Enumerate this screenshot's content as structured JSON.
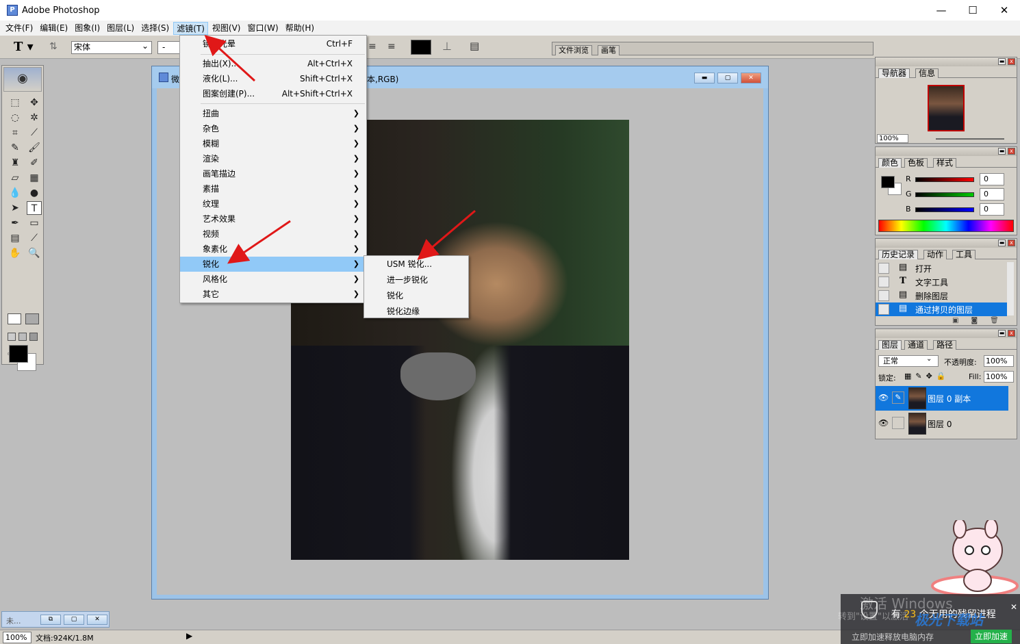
{
  "app": {
    "title": "Adobe Photoshop"
  },
  "menubar": [
    "文件(F)",
    "编辑(E)",
    "图象(I)",
    "图层(L)",
    "选择(S)",
    "滤镜(T)",
    "视图(V)",
    "窗口(W)",
    "帮助(H)"
  ],
  "toolbar": {
    "font": "宋体",
    "style": "-"
  },
  "well": {
    "tab1": "文件浏览",
    "tab2": "画笔"
  },
  "document": {
    "title_left": "微",
    "title_right": "本,RGB)"
  },
  "filter_menu": {
    "items": [
      {
        "label": "镜头光晕",
        "shortcut": "Ctrl+F"
      },
      {
        "label": "抽出(X)...",
        "shortcut": "Alt+Ctrl+X"
      },
      {
        "label": "液化(L)...",
        "shortcut": "Shift+Ctrl+X"
      },
      {
        "label": "图案创建(P)...",
        "shortcut": "Alt+Shift+Ctrl+X"
      },
      {
        "label": "扭曲"
      },
      {
        "label": "杂色"
      },
      {
        "label": "模糊"
      },
      {
        "label": "渲染"
      },
      {
        "label": "画笔描边"
      },
      {
        "label": "素描"
      },
      {
        "label": "纹理"
      },
      {
        "label": "艺术效果"
      },
      {
        "label": "视频"
      },
      {
        "label": "象素化"
      },
      {
        "label": "锐化"
      },
      {
        "label": "风格化"
      },
      {
        "label": "其它"
      }
    ]
  },
  "sharpen_submenu": [
    "USM 锐化...",
    "进一步锐化",
    "锐化",
    "锐化边缘"
  ],
  "navigator": {
    "tab1": "导航器",
    "tab2": "信息",
    "zoom": "100%"
  },
  "color_panel": {
    "tab1": "颜色",
    "tab2": "色板",
    "tab3": "样式",
    "r_label": "R",
    "g_label": "G",
    "b_label": "B",
    "r": "0",
    "g": "0",
    "b": "0"
  },
  "history_panel": {
    "tab1": "历史记录",
    "tab2": "动作",
    "tab3": "工具",
    "items": [
      "打开",
      "文字工具",
      "删除图层",
      "通过拷贝的图层"
    ]
  },
  "layers_panel": {
    "tab1": "图层",
    "tab2": "通道",
    "tab3": "路径",
    "blend": "正常",
    "opacity_label": "不透明度:",
    "opacity": "100%",
    "lock_label": "锁定:",
    "fill_label": "Fill:",
    "fill": "100%",
    "layers": [
      "图层 0 副本",
      "图层 0"
    ]
  },
  "statusbar": {
    "zoom": "100%",
    "doc": "文档:924K/1.8M"
  },
  "minimized": {
    "title": "未..."
  },
  "notification": {
    "wm1": "激活 Windows",
    "wm2": "转到\"设置\"以激活",
    "text_pre": "有",
    "count": "23",
    "text_post": "个无用的残留进程",
    "bottom": "立即加速释放电脑内存",
    "button": "立即加速",
    "brand": "极光下载站"
  },
  "colors": {
    "accent": "#91c9f7",
    "arrow": "#e01818",
    "selection": "#1177dd"
  }
}
